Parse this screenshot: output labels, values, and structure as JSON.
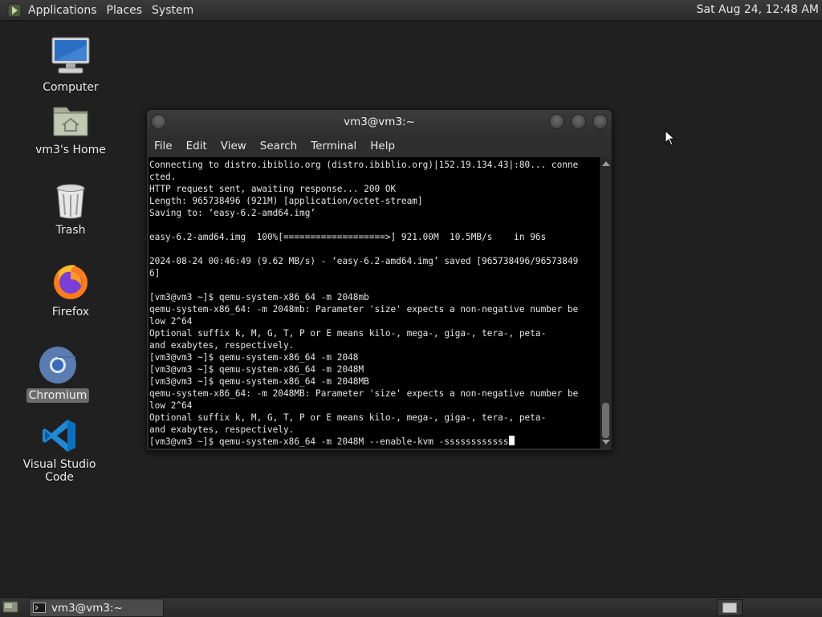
{
  "top_panel": {
    "menus": [
      "Applications",
      "Places",
      "System"
    ],
    "clock": "Sat Aug 24, 12:48 AM"
  },
  "desktop_icons": [
    {
      "label": "Computer",
      "icon": "computer-icon"
    },
    {
      "label": "vm3's Home",
      "icon": "home-folder-icon"
    },
    {
      "label": "Trash",
      "icon": "trash-icon"
    },
    {
      "label": "Firefox",
      "icon": "firefox-icon"
    },
    {
      "label": "Chromium",
      "icon": "chromium-icon",
      "selected": true
    },
    {
      "label": "Visual Studio Code",
      "icon": "vscode-icon"
    }
  ],
  "terminal": {
    "title": "vm3@vm3:~",
    "menu": [
      "File",
      "Edit",
      "View",
      "Search",
      "Terminal",
      "Help"
    ],
    "lines": [
      "Connecting to distro.ibiblio.org (distro.ibiblio.org)|152.19.134.43|:80... conne",
      "cted.",
      "HTTP request sent, awaiting response... 200 OK",
      "Length: 965738496 (921M) [application/octet-stream]",
      "Saving to: ‘easy-6.2-amd64.img’",
      "",
      "easy-6.2-amd64.img  100%[===================>] 921.00M  10.5MB/s    in 96s",
      "",
      "2024-08-24 00:46:49 (9.62 MB/s) - ‘easy-6.2-amd64.img’ saved [965738496/96573849",
      "6]",
      "",
      "[vm3@vm3 ~]$ qemu-system-x86_64 -m 2048mb",
      "qemu-system-x86_64: -m 2048mb: Parameter 'size' expects a non-negative number be",
      "low 2^64",
      "Optional suffix k, M, G, T, P or E means kilo-, mega-, giga-, tera-, peta-",
      "and exabytes, respectively.",
      "[vm3@vm3 ~]$ qemu-system-x86_64 -m 2048",
      "[vm3@vm3 ~]$ qemu-system-x86_64 -m 2048M",
      "[vm3@vm3 ~]$ qemu-system-x86_64 -m 2048MB",
      "qemu-system-x86_64: -m 2048MB: Parameter 'size' expects a non-negative number be",
      "low 2^64",
      "Optional suffix k, M, G, T, P or E means kilo-, mega-, giga-, tera-, peta-",
      "and exabytes, respectively."
    ],
    "current_input": "[vm3@vm3 ~]$ qemu-system-x86_64 -m 2048M --enable-kvm -ssssssssssss"
  },
  "taskbar": {
    "window_button": "vm3@vm3:~"
  }
}
